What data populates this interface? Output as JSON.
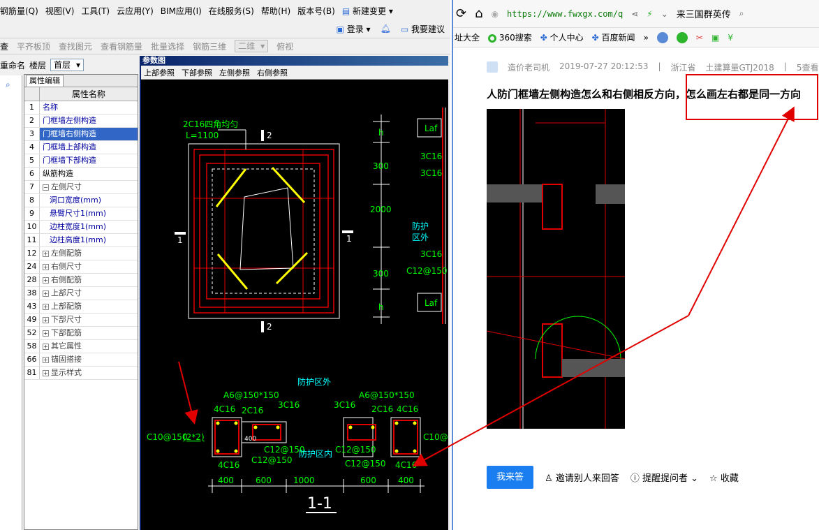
{
  "left_app": {
    "menu": [
      "钢筋量(Q)",
      "视图(V)",
      "工具(T)",
      "云应用(Y)",
      "BIM应用(I)",
      "在线服务(S)",
      "帮助(H)",
      "版本号(B)",
      "新建变更"
    ],
    "login": "登录",
    "suggest": "我要建议",
    "toolbar2": [
      "查",
      "平齐板顶",
      "查找图元",
      "查看钢筋量",
      "批量选择",
      "钢筋三维",
      "二维",
      "俯视"
    ],
    "toolbar3": {
      "rename": "重命名",
      "floor_label": "楼层",
      "floor_value": "首层"
    },
    "prop_tab": "属性编辑",
    "prop_header": "属性名称",
    "rows": [
      {
        "num": "1",
        "name": "名称",
        "style": "link"
      },
      {
        "num": "2",
        "name": "门框墙左侧构造",
        "style": "link"
      },
      {
        "num": "3",
        "name": "门框墙右侧构造",
        "style": "sel"
      },
      {
        "num": "4",
        "name": "门框墙上部构造",
        "style": "link"
      },
      {
        "num": "5",
        "name": "门框墙下部构造",
        "style": "link"
      },
      {
        "num": "6",
        "name": "纵筋构造",
        "style": "black"
      },
      {
        "num": "7",
        "name": "左侧尺寸",
        "style": "dark",
        "toggle": "−"
      },
      {
        "num": "8",
        "name": "洞口宽度(mm)",
        "style": "link",
        "indent": true
      },
      {
        "num": "9",
        "name": "悬臂尺寸1(mm)",
        "style": "link",
        "indent": true
      },
      {
        "num": "10",
        "name": "边柱宽度1(mm)",
        "style": "link",
        "indent": true
      },
      {
        "num": "11",
        "name": "边柱高度1(mm)",
        "style": "link",
        "indent": true
      },
      {
        "num": "12",
        "name": "左侧配筋",
        "style": "dark",
        "toggle": "+"
      },
      {
        "num": "24",
        "name": "右侧尺寸",
        "style": "dark",
        "toggle": "+"
      },
      {
        "num": "28",
        "name": "右侧配筋",
        "style": "dark",
        "toggle": "+"
      },
      {
        "num": "38",
        "name": "上部尺寸",
        "style": "dark",
        "toggle": "+"
      },
      {
        "num": "43",
        "name": "上部配筋",
        "style": "dark",
        "toggle": "+"
      },
      {
        "num": "49",
        "name": "下部尺寸",
        "style": "dark",
        "toggle": "+"
      },
      {
        "num": "52",
        "name": "下部配筋",
        "style": "dark",
        "toggle": "+"
      },
      {
        "num": "58",
        "name": "其它属性",
        "style": "dark",
        "toggle": "+"
      },
      {
        "num": "66",
        "name": "锚固搭接",
        "style": "dark",
        "toggle": "+"
      },
      {
        "num": "81",
        "name": "显示样式",
        "style": "dark",
        "toggle": "+"
      }
    ],
    "dialog": {
      "title": "参数图",
      "menu": [
        "上部参照",
        "下部参照",
        "左侧参照",
        "右侧参照"
      ],
      "labels": {
        "corner": "2C16四角均匀",
        "len": "L=1100",
        "sec2": "2",
        "sec1": "1",
        "h": "h",
        "d300": "300",
        "d2000": "2000",
        "laf": "Laf",
        "c3c16": "3C16",
        "fhqw": "防护",
        "fhqw2": "区外",
        "c12": "C12@150",
        "out": "防护区外",
        "in": "防护区内",
        "a6": "A6@150*150",
        "c4c16": "4C16",
        "c2c16": "2C16",
        "c10": "C10@150",
        "c10b": "(2*2)",
        "d400": "400",
        "d600": "600",
        "d1000": "1000",
        "c10r": "C10@1",
        "sect": "1-1",
        "d400v": "400"
      }
    }
  },
  "browser": {
    "url": "https://www.fwxgx.com/q",
    "search": "来三国群英传",
    "bookmarks": [
      "址大全",
      "360搜索",
      "个人中心",
      "百度新闻"
    ],
    "meta": [
      "造价老司机",
      "2019-07-27 20:12:53",
      "|",
      "浙江省",
      "土建算量GTJ2018",
      "|",
      "5查看"
    ],
    "title": "人防门框墙左侧构造怎么和右侧相反方向，怎么画左右都是同一方向",
    "answer_btn": "我来答",
    "invite": "邀请别人来回答",
    "remind": "提醒提问者",
    "fav": "收藏"
  },
  "colors": {
    "cad_red": "#e00000",
    "cad_yellow": "#ffff00",
    "cad_green": "#00ff00",
    "cad_cyan": "#00ffff",
    "accent": "#1a7ef0",
    "annot_red": "#e00000"
  }
}
